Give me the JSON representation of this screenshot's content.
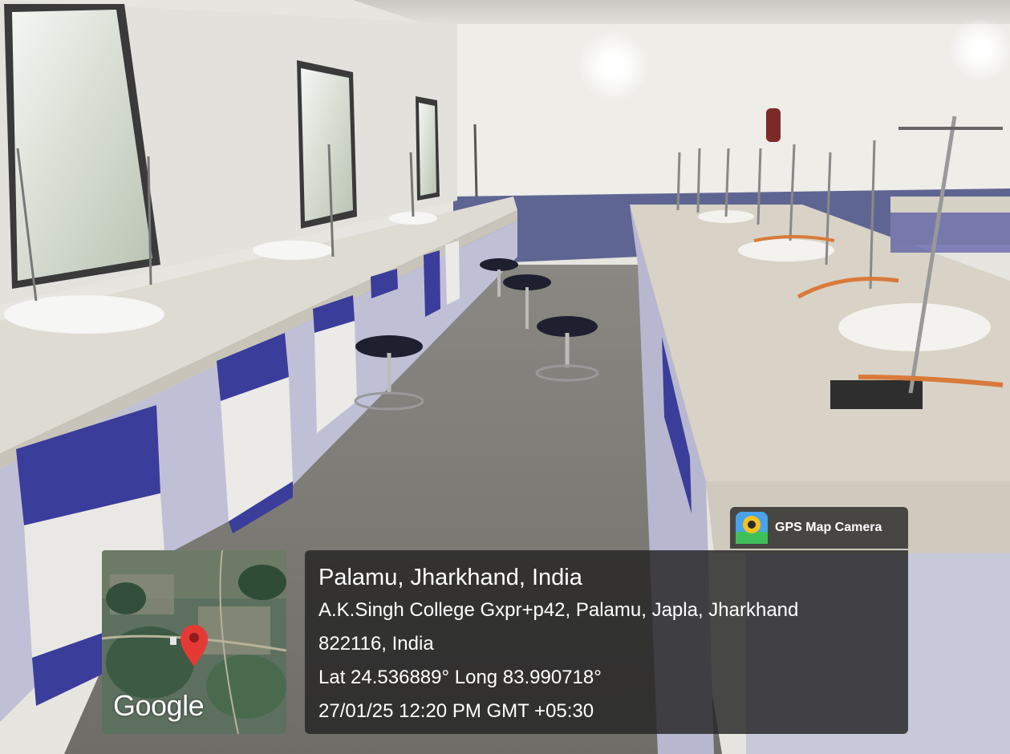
{
  "badge": {
    "label": "GPS Map Camera",
    "icon": "gps-map-camera-icon"
  },
  "map": {
    "logo": "Google",
    "pin_icon": "map-pin-icon",
    "pin_color": "#e53935"
  },
  "location": {
    "title": "Palamu, Jharkhand, India",
    "address_line1": "A.K.Singh College Gxpr+p42, Palamu, Japla, Jharkhand",
    "address_line2": "822116, India",
    "coordinates": "Lat 24.536889° Long 83.990718°",
    "timestamp": "27/01/25 12:20 PM GMT +05:30"
  },
  "colors": {
    "cabinet_blue": "#3a3d9a",
    "counter": "#dcd8cf",
    "wall": "#ecebe6",
    "overlay_bg": "#232323"
  }
}
